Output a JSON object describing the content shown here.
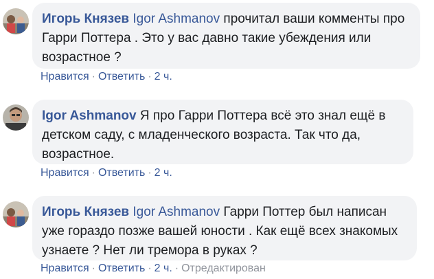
{
  "comments": [
    {
      "author": "Игорь Князев",
      "mention": "Igor Ashmanov",
      "text": "прочитал ваши комменты про Гарри Поттера . Это у вас давно такие убеждения или возрастное ?",
      "like": "Нравится",
      "reply": "Ответить",
      "time": "2 ч.",
      "edited": ""
    },
    {
      "author": "Igor Ashmanov",
      "mention": "",
      "text": "Я про Гарри Поттера всё это знал ещё в детском саду, с младенческого возраста. Так что да, возрастное.",
      "like": "Нравится",
      "reply": "Ответить",
      "time": "2 ч.",
      "edited": ""
    },
    {
      "author": "Игорь Князев",
      "mention": "Igor Ashmanov",
      "text": "Гарри Поттер был написан уже гораздо позже вашей юности . Как ещё всех знакомых узнаете ? Нет ли тремора в руках ?",
      "like": "Нравится",
      "reply": "Ответить",
      "time": "2 ч.",
      "edited": "Отредактирован"
    }
  ]
}
